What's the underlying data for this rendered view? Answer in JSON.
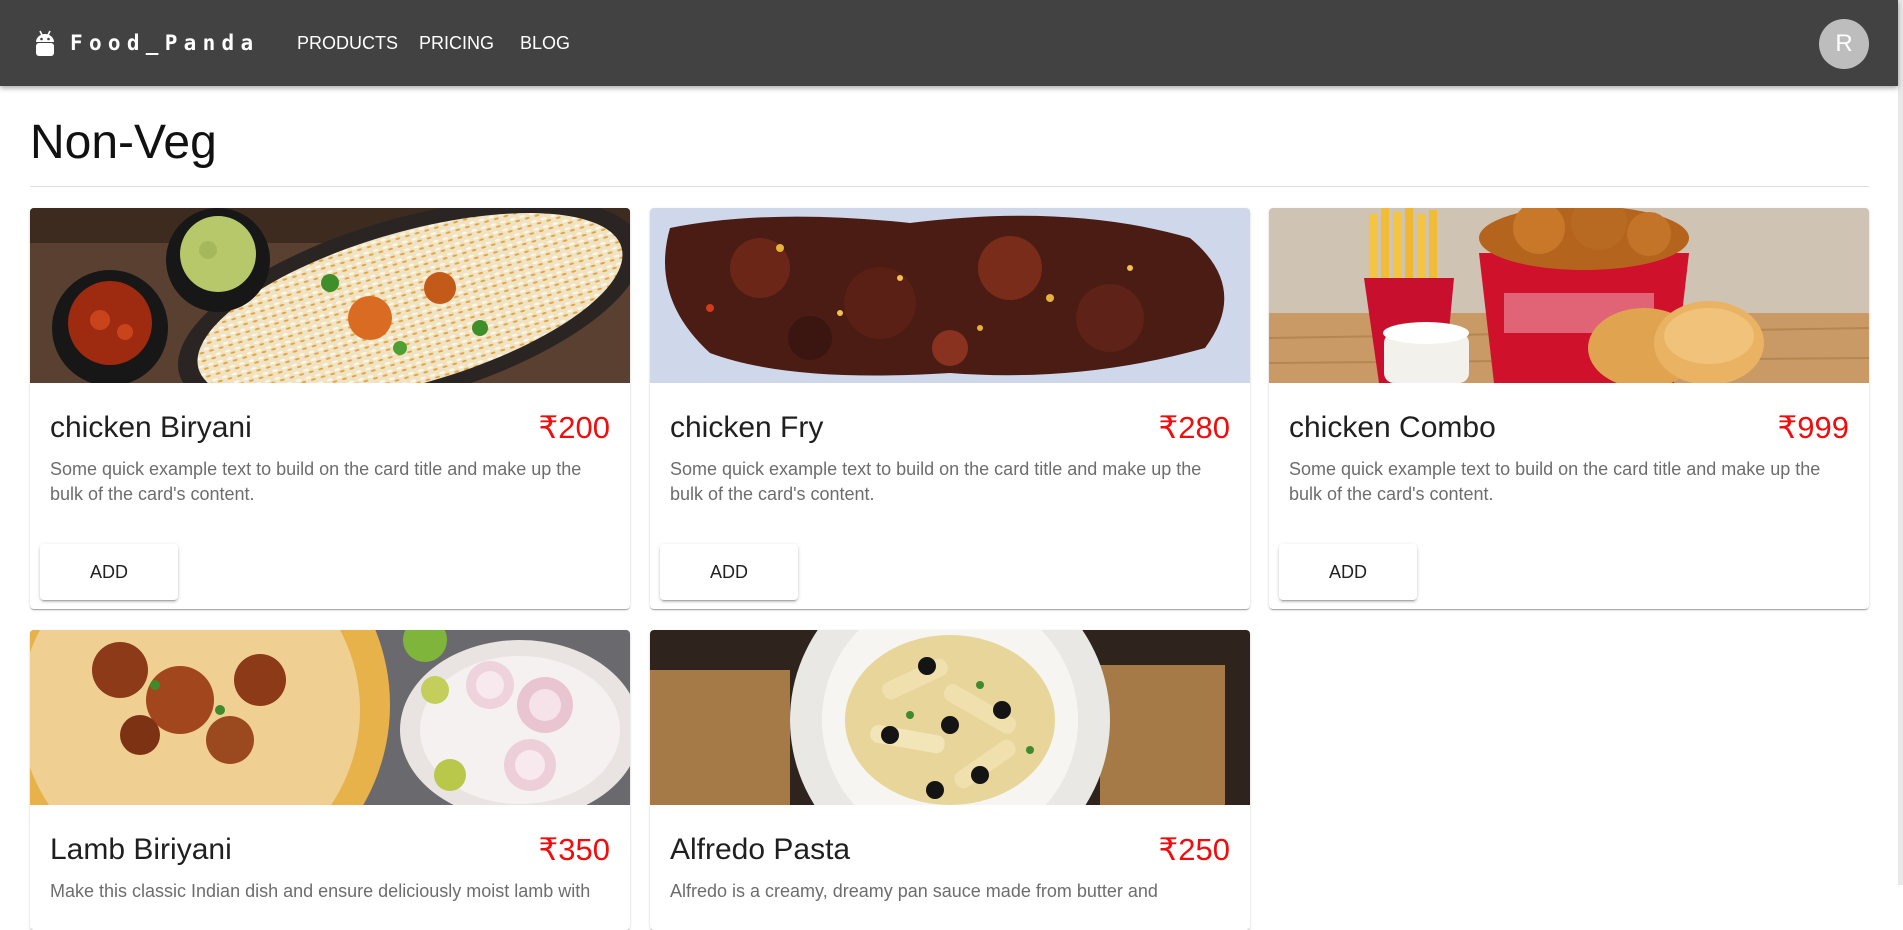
{
  "header": {
    "brand": "Food_Panda",
    "nav": [
      "PRODUCTS",
      "PRICING",
      "BLOG"
    ],
    "avatar_initial": "R"
  },
  "main": {
    "title": "Non-Veg",
    "cards": [
      {
        "name": "chicken Biryani",
        "price": "₹200",
        "description": "Some quick example text to build on the card title and make up the bulk of the card's content.",
        "button": "ADD"
      },
      {
        "name": "chicken Fry",
        "price": "₹280",
        "description": "Some quick example text to build on the card title and make up the bulk of the card's content.",
        "button": "ADD"
      },
      {
        "name": "chicken Combo",
        "price": "₹999",
        "description": "Some quick example text to build on the card title and make up the bulk of the card's content.",
        "button": "ADD"
      },
      {
        "name": "Lamb Biriyani",
        "price": "₹350",
        "description": "Make this classic Indian dish and ensure deliciously moist lamb with",
        "button": "ADD"
      },
      {
        "name": "Alfredo Pasta",
        "price": "₹250",
        "description": "Alfredo is a creamy, dreamy pan sauce made from butter and",
        "button": "ADD"
      }
    ]
  },
  "colors": {
    "appbar": "#424242",
    "price": "#f10d0d",
    "avatar": "#bdbdbd"
  },
  "icons": {
    "logo": "android-icon"
  }
}
